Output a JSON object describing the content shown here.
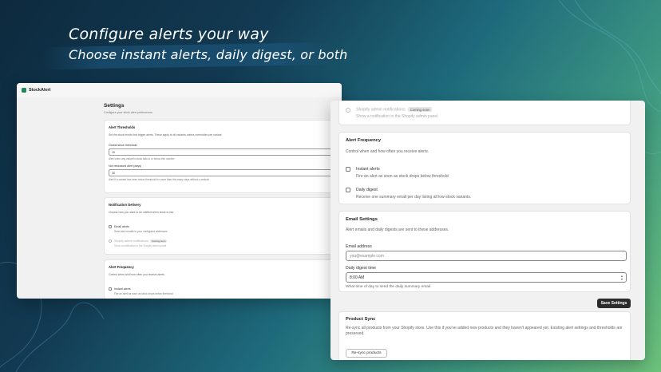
{
  "headline": {
    "line1": "Configure alerts your way",
    "line2": "Choose instant alerts, daily digest, or both"
  },
  "colors": {
    "brand": "#1f8a5a",
    "button_dark": "#2b2b2b"
  },
  "left_window": {
    "brand": "StockAlert",
    "logo_icon": "stockalert-logo-icon",
    "page_title": "Settings",
    "page_subtitle": "Configure your stock alert preferences",
    "thresholds": {
      "title": "Alert Thresholds",
      "desc": "Set the stock levels that trigger alerts. These apply to all variants unless overridden per variant.",
      "global_label": "Global stock threshold",
      "global_value": "10",
      "global_hint": "Alert when any variant's stock falls to or below this number",
      "ignored_label": "Not restocked alert (days)",
      "ignored_value": "30",
      "ignored_hint": "Alert if a variant has been below threshold for more than this many days without a restock"
    },
    "notification": {
      "title": "Notification Delivery",
      "desc": "Choose how you want to be notified when stock is low.",
      "email_label": "Email alerts",
      "email_desc": "Send alert emails to your configured addresses",
      "shopify_label": "Shopify admin notifications",
      "shopify_badge": "Coming soon",
      "shopify_desc": "Show a notification in the Shopify admin panel"
    },
    "frequency": {
      "title": "Alert Frequency",
      "desc": "Control when and how often you receive alerts.",
      "instant_label": "Instant alerts",
      "instant_desc": "Fire an alert as soon as stock drops below threshold"
    }
  },
  "right_window": {
    "shopify": {
      "label": "Shopify admin notifications",
      "badge": "Coming soon",
      "desc": "Show a notification in the Shopify admin panel"
    },
    "frequency": {
      "title": "Alert Frequency",
      "desc": "Control when and how often you receive alerts.",
      "instant_label": "Instant alerts",
      "instant_desc": "Fire an alert as soon as stock drops below threshold",
      "digest_label": "Daily digest",
      "digest_desc": "Receive one summary email per day listing all low-stock variants."
    },
    "email": {
      "title": "Email Settings",
      "desc": "Alert emails and daily digests are sent to these addresses.",
      "address_label": "Email address",
      "address_placeholder": "you@example.com",
      "time_label": "Daily digest time",
      "time_value": "8:00 AM",
      "time_hint": "What time of day to send the daily summary email."
    },
    "save_label": "Save Settings",
    "sync": {
      "title": "Product Sync",
      "desc": "Re-sync all products from your Shopify store. Use this if you've added new products and they haven't appeared yet. Existing alert settings and thresholds are preserved.",
      "button_label": "Re-sync products"
    }
  }
}
